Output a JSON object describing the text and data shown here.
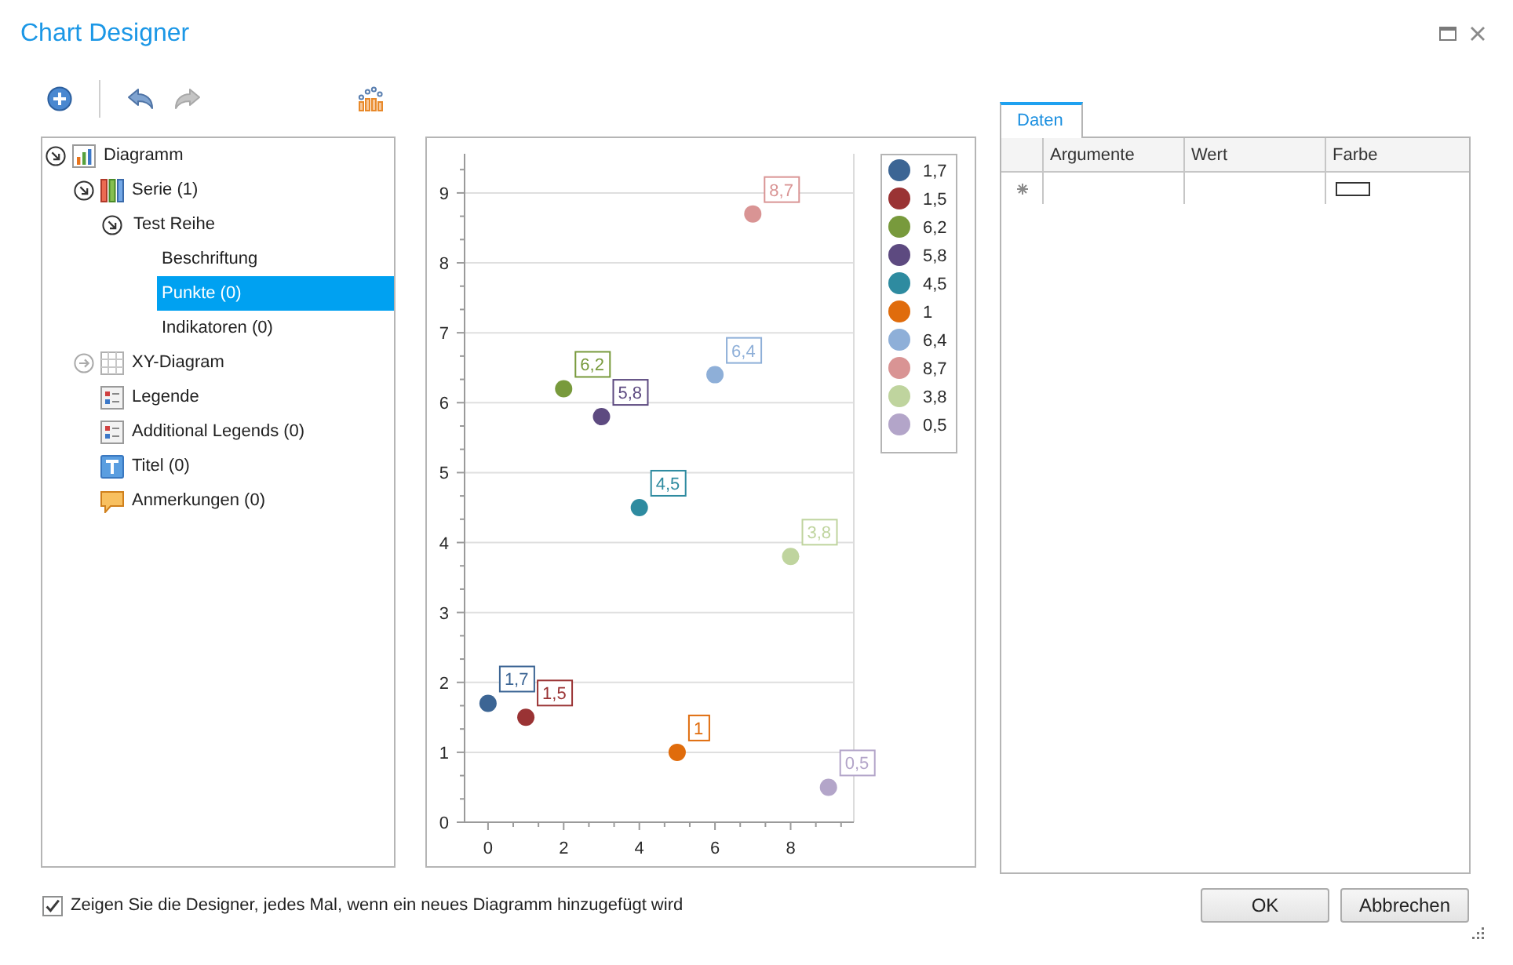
{
  "window": {
    "title": "Chart Designer"
  },
  "toolbar": {
    "groups": [
      {
        "items": [
          {
            "kind": "add",
            "disabled": false
          }
        ]
      },
      {
        "items": [
          {
            "kind": "undo",
            "disabled": false
          },
          {
            "kind": "redo",
            "disabled": true
          }
        ]
      },
      {
        "items": [
          {
            "kind": "wizard",
            "disabled": false
          }
        ]
      }
    ]
  },
  "tree": {
    "items": [
      {
        "label": "Diagramm",
        "kind": "chart",
        "expanded": true,
        "selected": false,
        "children": [
          {
            "label": "Serie (1)",
            "kind": "series",
            "expanded": true,
            "selected": false,
            "children": [
              {
                "label": "Test Reihe",
                "expanded": true,
                "selected": false,
                "children": [
                  {
                    "label": "Beschriftung",
                    "selected": false
                  },
                  {
                    "label": "Punkte (0)",
                    "selected": true
                  },
                  {
                    "label": "Indikatoren (0)",
                    "selected": false
                  }
                ]
              }
            ]
          },
          {
            "label": "XY-Diagram",
            "kind": "diagram",
            "expanded": false,
            "selected": false
          },
          {
            "label": "Legende",
            "kind": "legend",
            "selected": false
          },
          {
            "label": "Additional Legends (0)",
            "kind": "legend",
            "selected": false
          },
          {
            "label": "Titel (0)",
            "kind": "title",
            "selected": false
          },
          {
            "label": "Anmerkungen (0)",
            "kind": "annotation",
            "selected": false
          }
        ]
      }
    ]
  },
  "chart": {
    "chart_data": {
      "type": "scatter",
      "x": [
        0,
        1,
        2,
        3,
        4,
        5,
        6,
        7,
        8,
        9
      ],
      "series": [
        {
          "name": "1,7",
          "color": "#3c6594",
          "values": [
            1.7,
            null,
            null,
            null,
            null,
            null,
            null,
            null,
            null,
            null
          ]
        },
        {
          "name": "1,5",
          "color": "#9a3334",
          "values": [
            null,
            1.5,
            null,
            null,
            null,
            null,
            null,
            null,
            null,
            null
          ]
        },
        {
          "name": "6,2",
          "color": "#789a3c",
          "values": [
            null,
            null,
            6.2,
            null,
            null,
            null,
            null,
            null,
            null,
            null
          ]
        },
        {
          "name": "5,8",
          "color": "#5d4a80",
          "values": [
            null,
            null,
            null,
            5.8,
            null,
            null,
            null,
            null,
            null,
            null
          ]
        },
        {
          "name": "4,5",
          "color": "#2e8ba0",
          "values": [
            null,
            null,
            null,
            null,
            4.5,
            null,
            null,
            null,
            null,
            null
          ]
        },
        {
          "name": "1",
          "color": "#e06c0c",
          "values": [
            null,
            null,
            null,
            null,
            null,
            1,
            null,
            null,
            null,
            null
          ]
        },
        {
          "name": "6,4",
          "color": "#8eafd8",
          "values": [
            null,
            null,
            null,
            null,
            null,
            null,
            6.4,
            null,
            null,
            null
          ]
        },
        {
          "name": "8,7",
          "color": "#d99494",
          "values": [
            null,
            null,
            null,
            null,
            null,
            null,
            null,
            8.7,
            null,
            null
          ]
        },
        {
          "name": "3,8",
          "color": "#bfd49e",
          "values": [
            null,
            null,
            null,
            null,
            null,
            null,
            null,
            null,
            3.8,
            null
          ]
        },
        {
          "name": "0,5",
          "color": "#b3a5c9",
          "values": [
            null,
            null,
            null,
            null,
            null,
            null,
            null,
            null,
            null,
            0.5
          ]
        }
      ],
      "xlim": [
        -0.62,
        9.67
      ],
      "ylim": [
        0,
        9.56
      ],
      "xticks": [
        0,
        2,
        4,
        6,
        8
      ],
      "yticks": [
        0,
        1,
        2,
        3,
        4,
        5,
        6,
        7,
        8,
        9
      ],
      "grid": true,
      "legend": true,
      "value_labels": [
        "1,7",
        "1,5",
        "6,2",
        "5,8",
        "4,5",
        "1",
        "6,4",
        "8,7",
        "3,8",
        "0,5"
      ]
    }
  },
  "tabs": [
    {
      "label": "Daten",
      "selected": true
    }
  ],
  "table": {
    "columns": [
      "Argumente",
      "Wert",
      "Farbe"
    ],
    "new_row": true
  },
  "footer": {
    "checkbox": {
      "label": "Zeigen Sie die Designer, jedes Mal, wenn ein neues Diagramm hinzugefügt wird",
      "checked": true
    },
    "buttons": [
      "OK",
      "Abbrechen"
    ]
  }
}
